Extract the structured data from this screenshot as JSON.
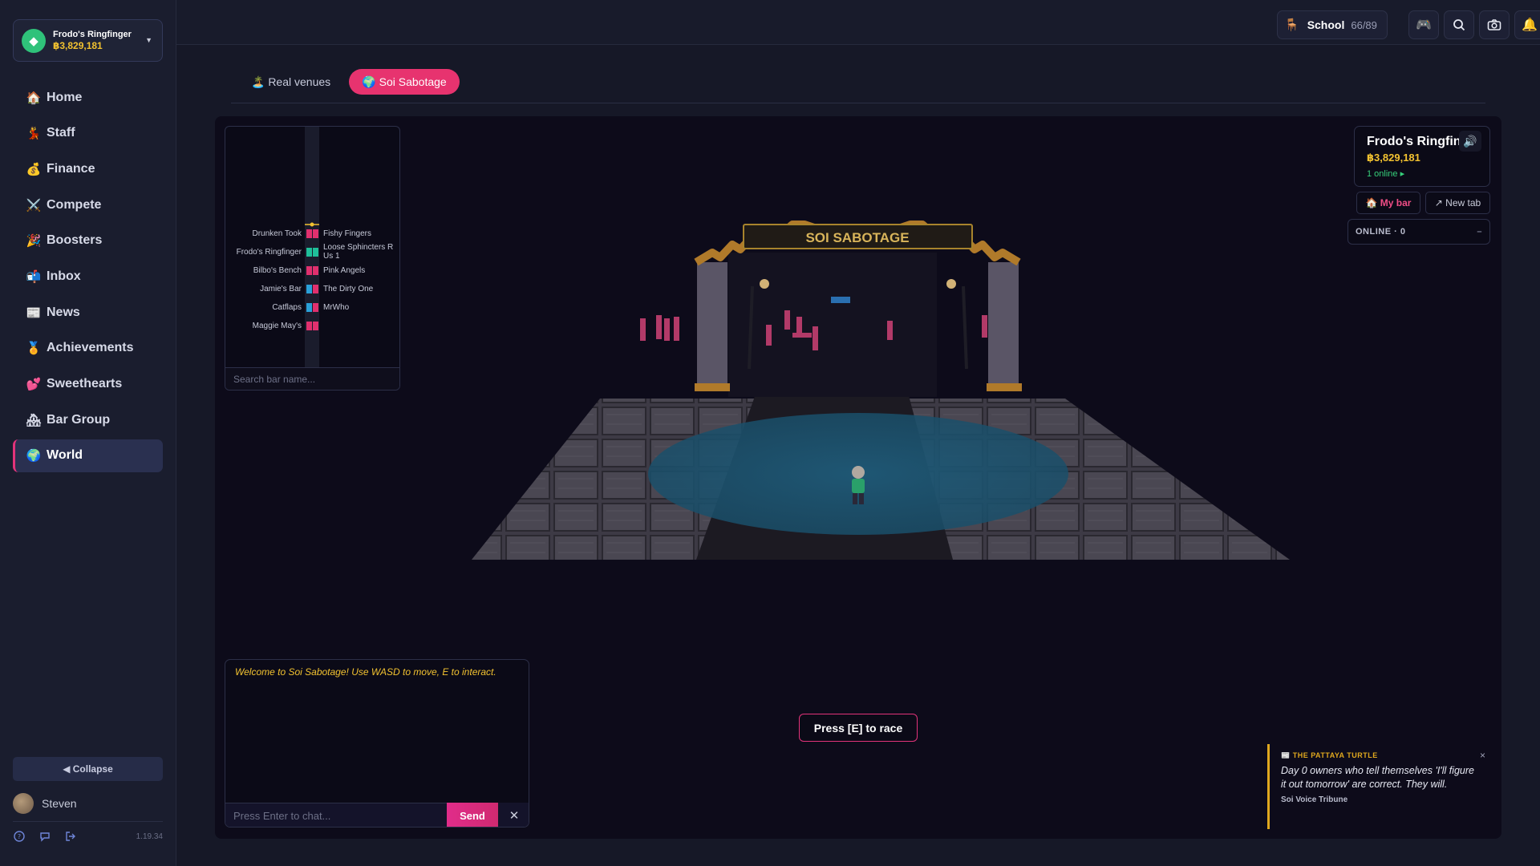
{
  "account": {
    "bar_name": "Frodo's Ringfinger",
    "balance": "฿3,829,181",
    "icon": "gem-icon"
  },
  "sidebar": {
    "items": [
      {
        "label": "Home",
        "icon": "🏠"
      },
      {
        "label": "Staff",
        "icon": "💃"
      },
      {
        "label": "Finance",
        "icon": "💰"
      },
      {
        "label": "Compete",
        "icon": "⚔️"
      },
      {
        "label": "Boosters",
        "icon": "🎉"
      },
      {
        "label": "Inbox",
        "icon": "📬"
      },
      {
        "label": "News",
        "icon": "📰"
      },
      {
        "label": "Achievements",
        "icon": "🏅"
      },
      {
        "label": "Sweethearts",
        "icon": "💕"
      },
      {
        "label": "Bar Group",
        "icon": "🏘"
      },
      {
        "label": "World",
        "icon": "🌍"
      }
    ],
    "active": "World",
    "collapse_label": "◀ Collapse",
    "user_name": "Steven",
    "version": "1.19.34"
  },
  "topbar": {
    "school_icon": "🪑",
    "school_label": "School",
    "school_count": "66/89"
  },
  "tabs": {
    "real_venues": "🏝️ Real venues",
    "soi_sabotage": "🌍 Soi Sabotage"
  },
  "race": {
    "rows": [
      {
        "left": "Drunken Took",
        "right": "Fishy Fingers",
        "left_color": "#e0306e",
        "right_color": "#e0306e"
      },
      {
        "left": "Frodo's Ringfinger",
        "right": "Loose Sphincters R Us 1",
        "left_color": "#1fbf9a",
        "right_color": "#1fbf9a"
      },
      {
        "left": "Bilbo's Bench",
        "right": "Pink Angels",
        "left_color": "#e0306e",
        "right_color": "#e0306e"
      },
      {
        "left": "Jamie's Bar",
        "right": "The Dirty One",
        "left_color": "#2aa0d8",
        "right_color": "#e0306e"
      },
      {
        "left": "Catflaps",
        "right": "MrWho",
        "left_color": "#2aa0d8",
        "right_color": "#e0306e"
      },
      {
        "left": "Maggie May's",
        "right": "",
        "left_color": "#e0306e",
        "right_color": "#e0306e"
      }
    ],
    "search_placeholder": "Search bar name..."
  },
  "scene": {
    "sign_text": "SOI SABOTAGE"
  },
  "bar_panel": {
    "name": "Frodo's Ringfinger",
    "money": "฿3,829,181",
    "online": "1 online ▸",
    "my_bar": "🏠 My bar",
    "new_tab": "↗ New tab",
    "online_header": "ONLINE · 0",
    "online_toggle": "–"
  },
  "chat": {
    "welcome": "Welcome to Soi Sabotage! Use WASD to move, E to interact.",
    "placeholder": "Press Enter to chat...",
    "send_label": "Send",
    "close": "✕"
  },
  "prompt": {
    "text": "Press [E] to race"
  },
  "news": {
    "source": "📰 THE PATTAYA TURTLE",
    "text": "Day 0 owners who tell themselves 'I'll figure it out tomorrow' are correct. They will.",
    "byline": "Soi Voice Tribune",
    "close": "×"
  }
}
